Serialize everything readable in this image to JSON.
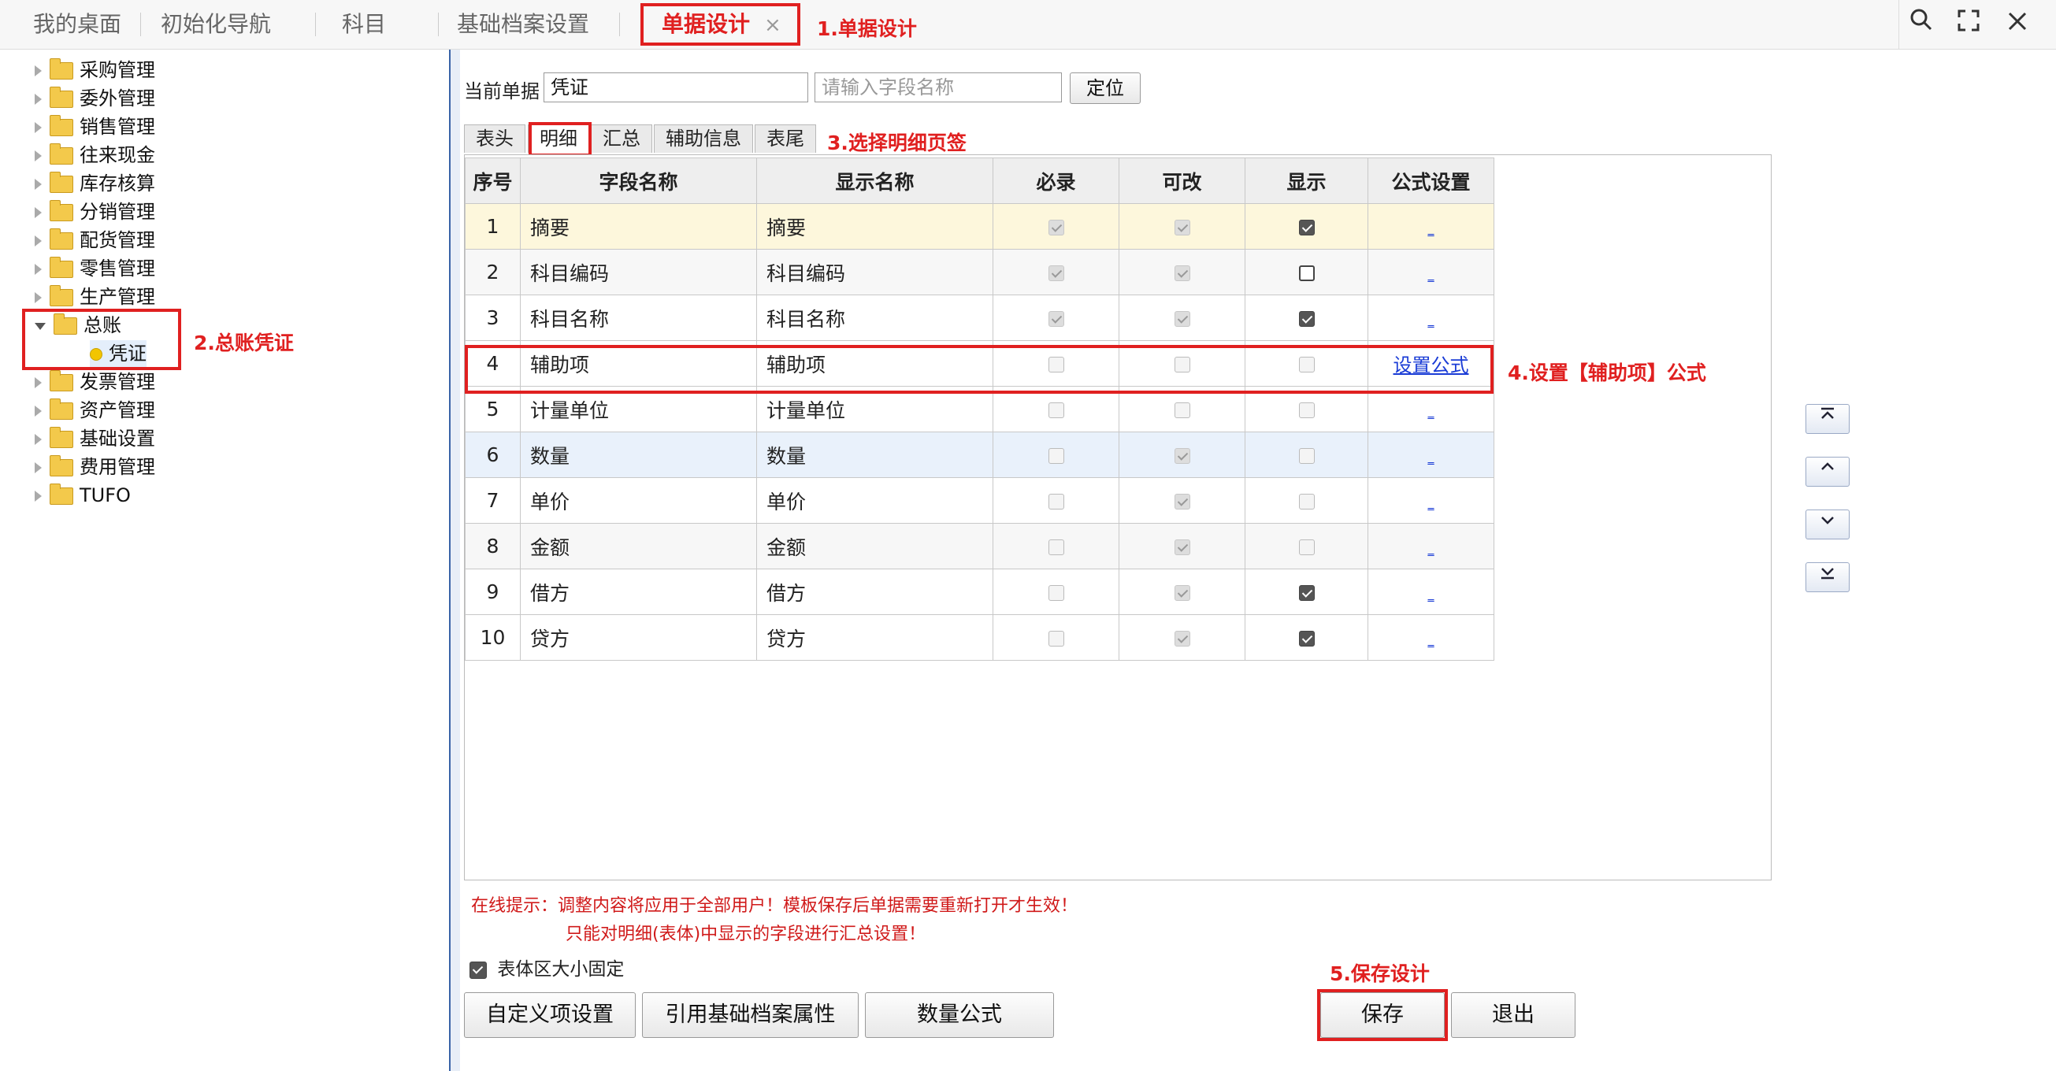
{
  "top_tabs": [
    "我的桌面",
    "初始化导航",
    "科目",
    "基础档案设置",
    "单据设计"
  ],
  "active_tab_close": "×",
  "window_buttons": {
    "search": "search-icon",
    "fullscreen": "fullscreen-icon",
    "close": "close-icon"
  },
  "annotations": {
    "a1": "1.单据设计",
    "a2": "2.总账凭证",
    "a3": "3.选择明细页签",
    "a4": "4.设置【辅助项】公式",
    "a5": "5.保存设计"
  },
  "tree": {
    "items": [
      "采购管理",
      "委外管理",
      "销售管理",
      "往来现金",
      "库存核算",
      "分销管理",
      "配货管理",
      "零售管理",
      "生产管理"
    ],
    "open_item": "总账",
    "child": "凭证",
    "items_after": [
      "发票管理",
      "资产管理",
      "基础设置",
      "费用管理",
      "TUFO"
    ]
  },
  "form": {
    "current_label": "当前单据",
    "current_value": "凭证",
    "field_placeholder": "请输入字段名称",
    "locate_button": "定位"
  },
  "sub_tabs": [
    "表头",
    "明细",
    "汇总",
    "辅助信息",
    "表尾"
  ],
  "grid": {
    "headers": [
      "序号",
      "字段名称",
      "显示名称",
      "必录",
      "可改",
      "显示",
      "公式设置"
    ],
    "rows": [
      {
        "no": "1",
        "field": "摘要",
        "display": "摘要",
        "required": "on-dis",
        "editable": "on-dis",
        "show": "on-en",
        "formula": "_"
      },
      {
        "no": "2",
        "field": "科目编码",
        "display": "科目编码",
        "required": "on-dis",
        "editable": "on-dis",
        "show": "off-en",
        "formula": "_"
      },
      {
        "no": "3",
        "field": "科目名称",
        "display": "科目名称",
        "required": "on-dis",
        "editable": "on-dis",
        "show": "on-en",
        "formula": "_"
      },
      {
        "no": "4",
        "field": "辅助项",
        "display": "辅助项",
        "required": "off-dis",
        "editable": "off-dis",
        "show": "off-dis",
        "formula": "设置公式"
      },
      {
        "no": "5",
        "field": "计量单位",
        "display": "计量单位",
        "required": "off-dis",
        "editable": "off-dis",
        "show": "off-dis",
        "formula": "_"
      },
      {
        "no": "6",
        "field": "数量",
        "display": "数量",
        "required": "off-dis",
        "editable": "on-dis",
        "show": "off-dis",
        "formula": "_"
      },
      {
        "no": "7",
        "field": "单价",
        "display": "单价",
        "required": "off-dis",
        "editable": "on-dis",
        "show": "off-dis",
        "formula": "_"
      },
      {
        "no": "8",
        "field": "金额",
        "display": "金额",
        "required": "off-dis",
        "editable": "on-dis",
        "show": "off-dis",
        "formula": "_"
      },
      {
        "no": "9",
        "field": "借方",
        "display": "借方",
        "required": "off-dis",
        "editable": "on-dis",
        "show": "on-en",
        "formula": "_"
      },
      {
        "no": "10",
        "field": "贷方",
        "display": "贷方",
        "required": "off-dis",
        "editable": "on-dis",
        "show": "on-en",
        "formula": "_"
      }
    ]
  },
  "move_buttons": [
    "⤒",
    "⌃",
    "⌄",
    "⤓"
  ],
  "hints": {
    "line1": "在线提示：调整内容将应用于全部用户！模板保存后单据需要重新打开才生效！",
    "line2": "只能对明细(表体)中显示的字段进行汇总设置！"
  },
  "fixed_size": {
    "label": "表体区大小固定",
    "checked": true
  },
  "buttons": {
    "custom": "自定义项设置",
    "ref": "引用基础档案属性",
    "qty": "数量公式",
    "save": "保存",
    "exit": "退出"
  },
  "colors": {
    "annotation": "#e02020",
    "link": "#1a3cd6"
  }
}
